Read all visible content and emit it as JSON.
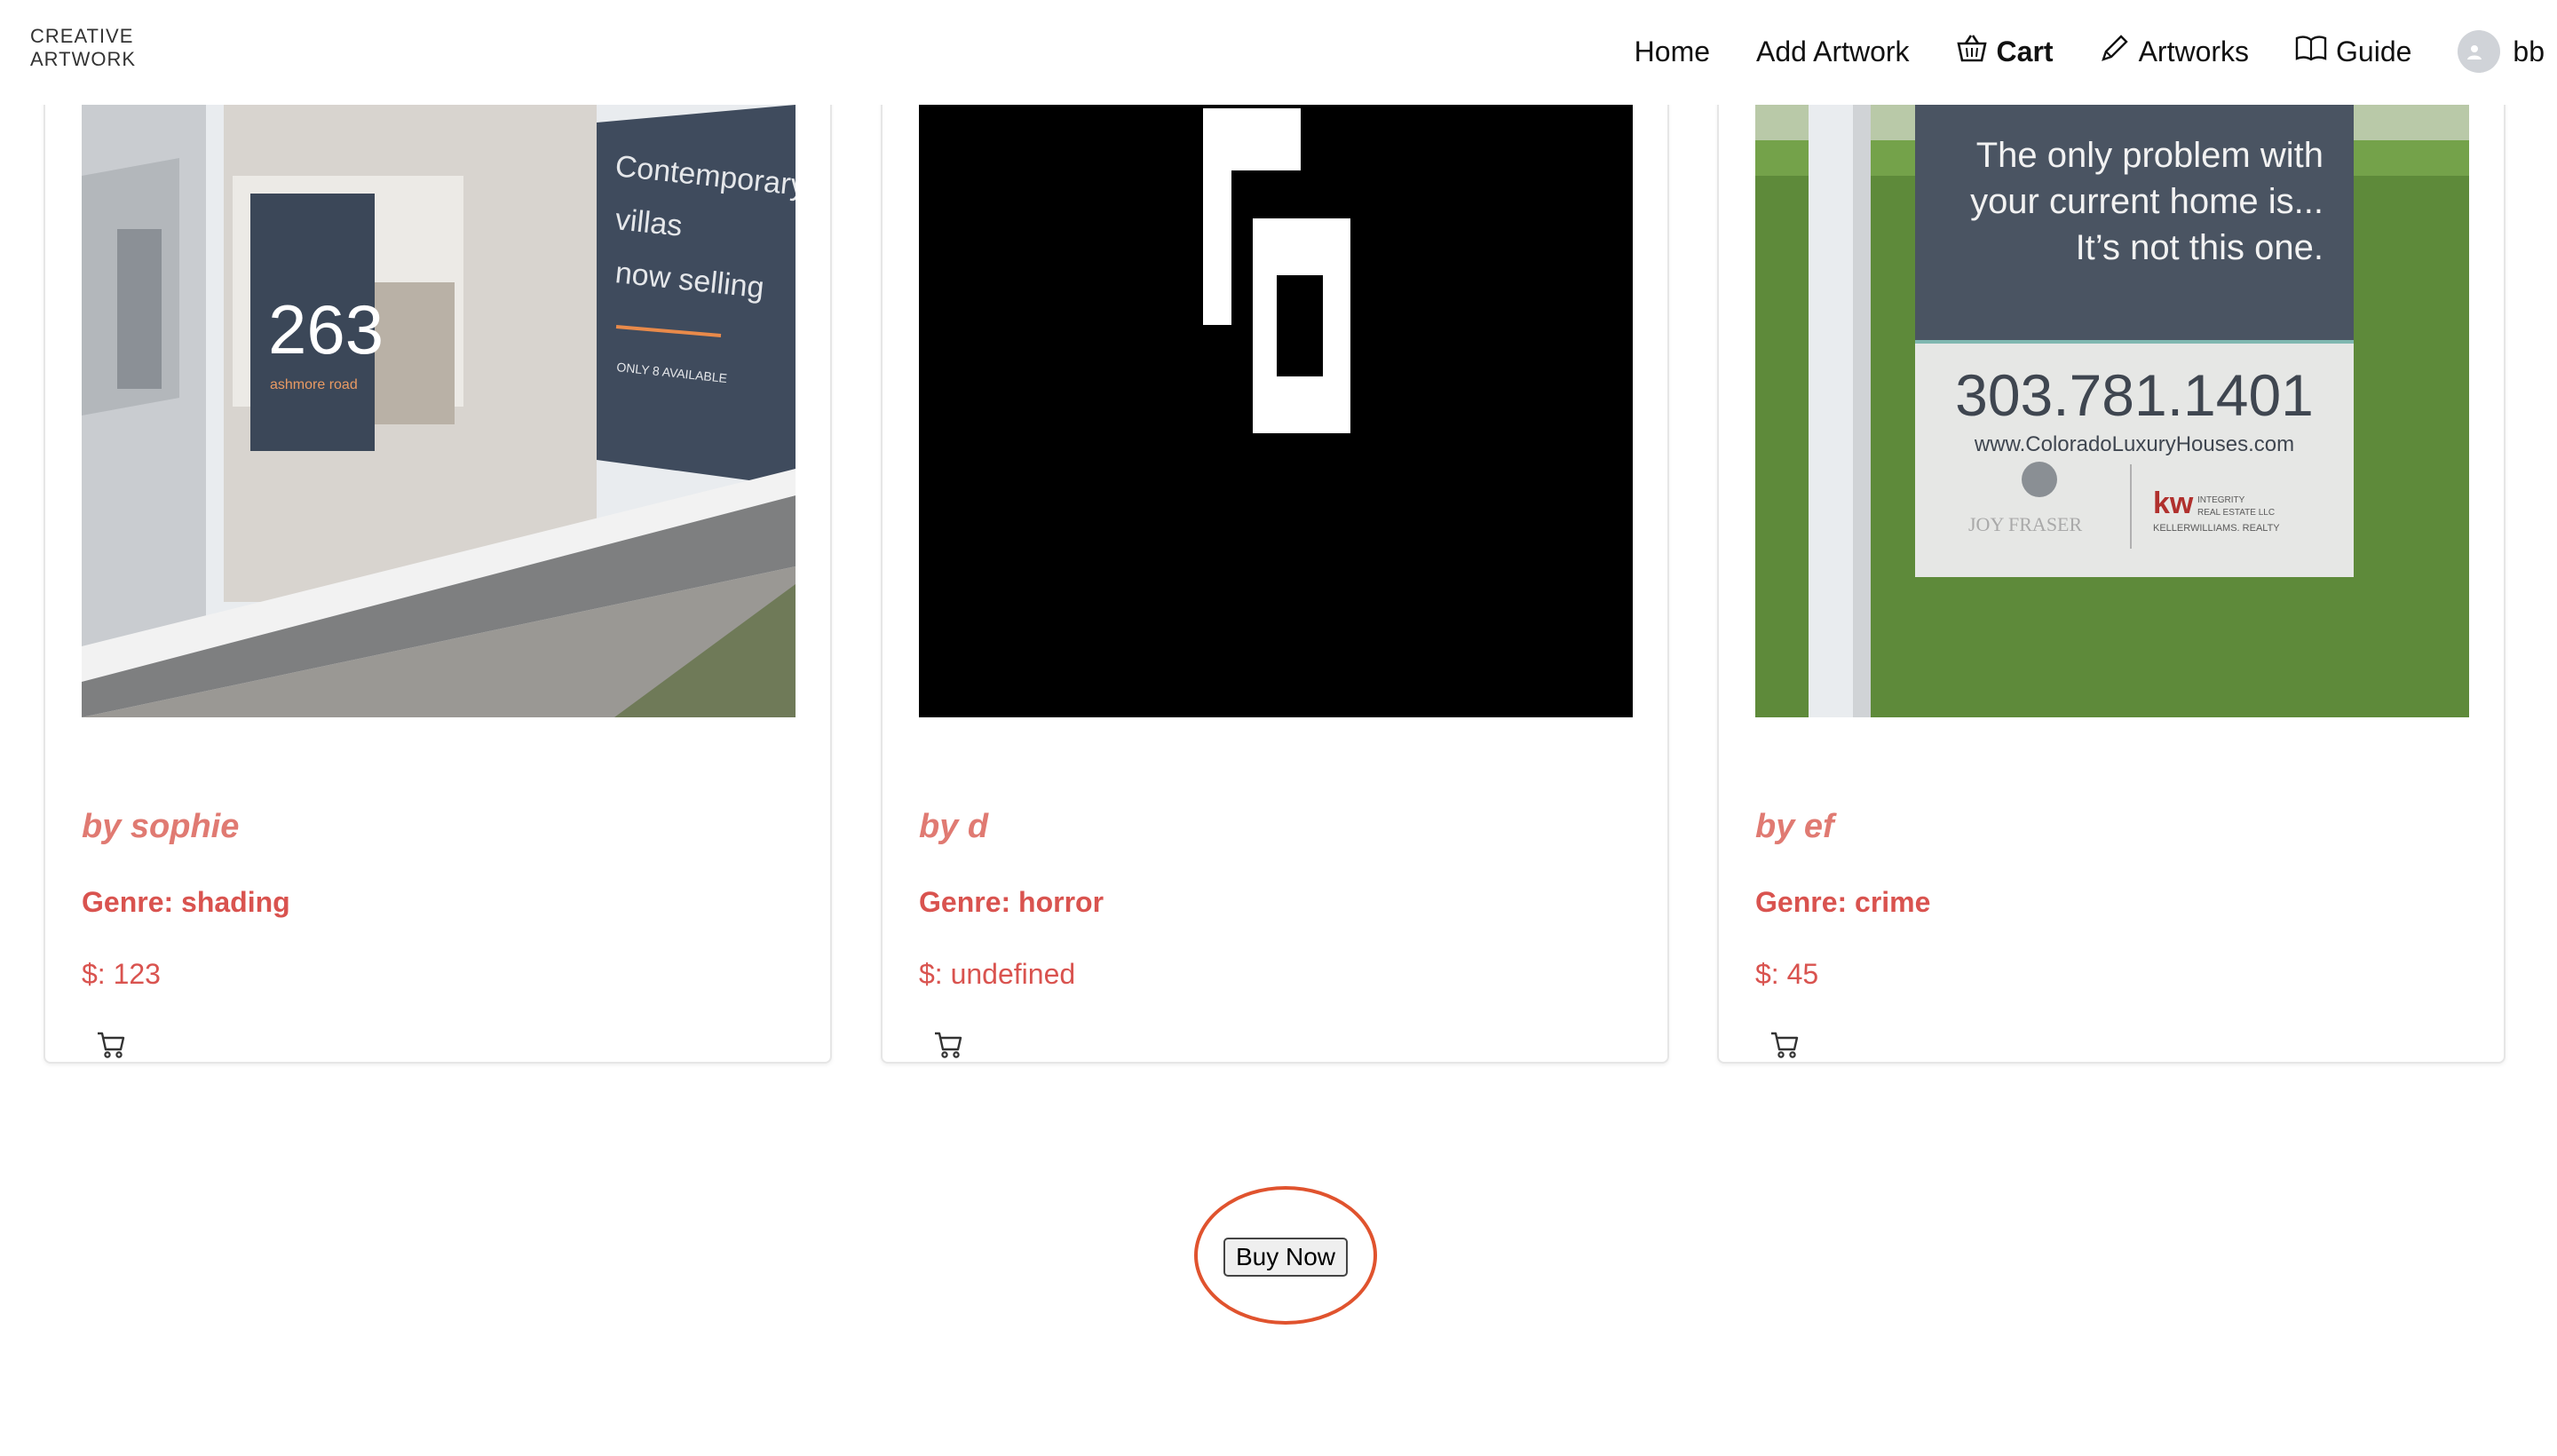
{
  "brand": {
    "line1": "CREATIVE",
    "line2": "ARTWORK"
  },
  "nav": {
    "home": "Home",
    "add_artwork": "Add Artwork",
    "cart": "Cart",
    "artworks": "Artworks",
    "guide": "Guide",
    "user": "bb"
  },
  "cards": [
    {
      "author": "by sophie",
      "genre": "Genre: shading",
      "price": "$: 123",
      "image_text": {
        "number": "263",
        "street": "ashmore road",
        "headline": [
          "Contemporary",
          "villas",
          "now selling"
        ],
        "note": "ONLY 8 AVAILABLE"
      }
    },
    {
      "author": "by d",
      "genre": "Genre: horror",
      "price": "$: undefined"
    },
    {
      "author": "by ef",
      "genre": "Genre: crime",
      "price": "$: 45",
      "image_text": {
        "tagline_1": "The only problem with",
        "tagline_2": "your current home is...",
        "tagline_3": "It’s not this one.",
        "phone": "303.781.1401",
        "url": "www.ColoradoLuxuryHouses.com",
        "agent": "JOY FRASER",
        "kw": "kw",
        "kw_sub1": "INTEGRITY",
        "kw_sub2": "REAL ESTATE LLC",
        "kw_sub3": "KELLERWILLIAMS. REALTY"
      }
    }
  ],
  "actions": {
    "buy_now": "Buy Now"
  },
  "colors": {
    "accent_text": "#d9534f",
    "author_text": "#e07a72",
    "highlight_ring": "#e0532e"
  }
}
